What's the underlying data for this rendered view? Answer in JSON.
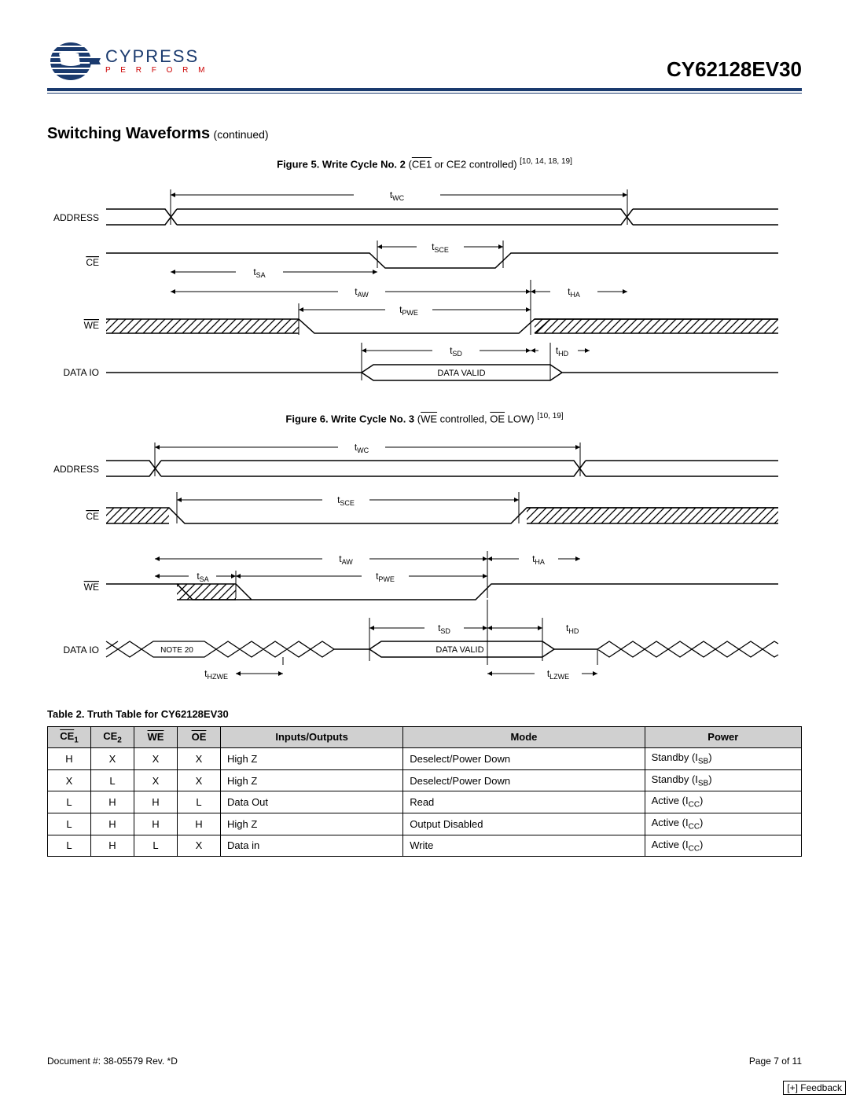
{
  "header": {
    "logo_main": "CYPRESS",
    "logo_sub": "P E R F O R M",
    "part_number": "CY62128EV30"
  },
  "section": {
    "title": "Switching Waveforms",
    "continued": "(continued)"
  },
  "figure5": {
    "prefix": "Figure 5.  Write Cycle No. 2",
    "ctrl_open": " (",
    "ce1": "CE1",
    "mid": " or CE2 controlled) ",
    "refs": "[10, 14, 18, 19]",
    "signals": [
      "ADDRESS",
      "CE",
      "WE",
      "DATA  IO"
    ],
    "labels": {
      "tWC": "tWC",
      "tSCE": "tSCE",
      "tSA": "tSA",
      "tAW": "tAW",
      "tHA": "tHA",
      "tPWE": "tPWE",
      "tSD": "tSD",
      "tHD": "tHD",
      "data_valid": "DATA VALID"
    }
  },
  "figure6": {
    "prefix": "Figure 6.  Write Cycle No. 3",
    "ctrl_open": " (",
    "we": "WE",
    "mid1": " controlled, ",
    "oe": "OE",
    "mid2": " LOW) ",
    "refs": "[10, 19]",
    "signals": [
      "ADDRESS",
      "CE",
      "WE",
      "DATA  IO"
    ],
    "labels": {
      "tWC": "tWC",
      "tSCE": "tSCE",
      "tSA": "tSA",
      "tAW": "tAW",
      "tHA": "tHA",
      "tPWE": "tPWE",
      "tSD": "tSD",
      "tHD": "tHD",
      "tHZWE": "tHZWE",
      "tLZWE": "tLZWE",
      "note20": "NOTE 20",
      "data_valid": "DATA VALID"
    }
  },
  "table2": {
    "title": "Table 2.  Truth Table for CY62128EV30",
    "headers": {
      "ce1_base": "CE",
      "ce1_sub": "1",
      "ce2_base": "CE",
      "ce2_sub": "2",
      "we": "WE",
      "oe": "OE",
      "io": "Inputs/Outputs",
      "mode": "Mode",
      "power": "Power"
    },
    "rows": [
      {
        "ce1": "H",
        "ce2": "X",
        "we": "X",
        "oe": "X",
        "io": "High Z",
        "mode": "Deselect/Power Down",
        "power_pre": "Standby (I",
        "power_sub": "SB",
        "power_post": ")"
      },
      {
        "ce1": "X",
        "ce2": "L",
        "we": "X",
        "oe": "X",
        "io": "High Z",
        "mode": "Deselect/Power Down",
        "power_pre": "Standby (I",
        "power_sub": "SB",
        "power_post": ")"
      },
      {
        "ce1": "L",
        "ce2": "H",
        "we": "H",
        "oe": "L",
        "io": "Data Out",
        "mode": "Read",
        "power_pre": "Active (I",
        "power_sub": "CC",
        "power_post": ")"
      },
      {
        "ce1": "L",
        "ce2": "H",
        "we": "H",
        "oe": "H",
        "io": "High Z",
        "mode": "Output Disabled",
        "power_pre": "Active (I",
        "power_sub": "CC",
        "power_post": ")"
      },
      {
        "ce1": "L",
        "ce2": "H",
        "we": "L",
        "oe": "X",
        "io": "Data in",
        "mode": "Write",
        "power_pre": "Active (I",
        "power_sub": "CC",
        "power_post": ")"
      }
    ]
  },
  "footer": {
    "doc": "Document #: 38-05579 Rev. *D",
    "page": "Page 7 of 11",
    "feedback": "[+] Feedback"
  }
}
